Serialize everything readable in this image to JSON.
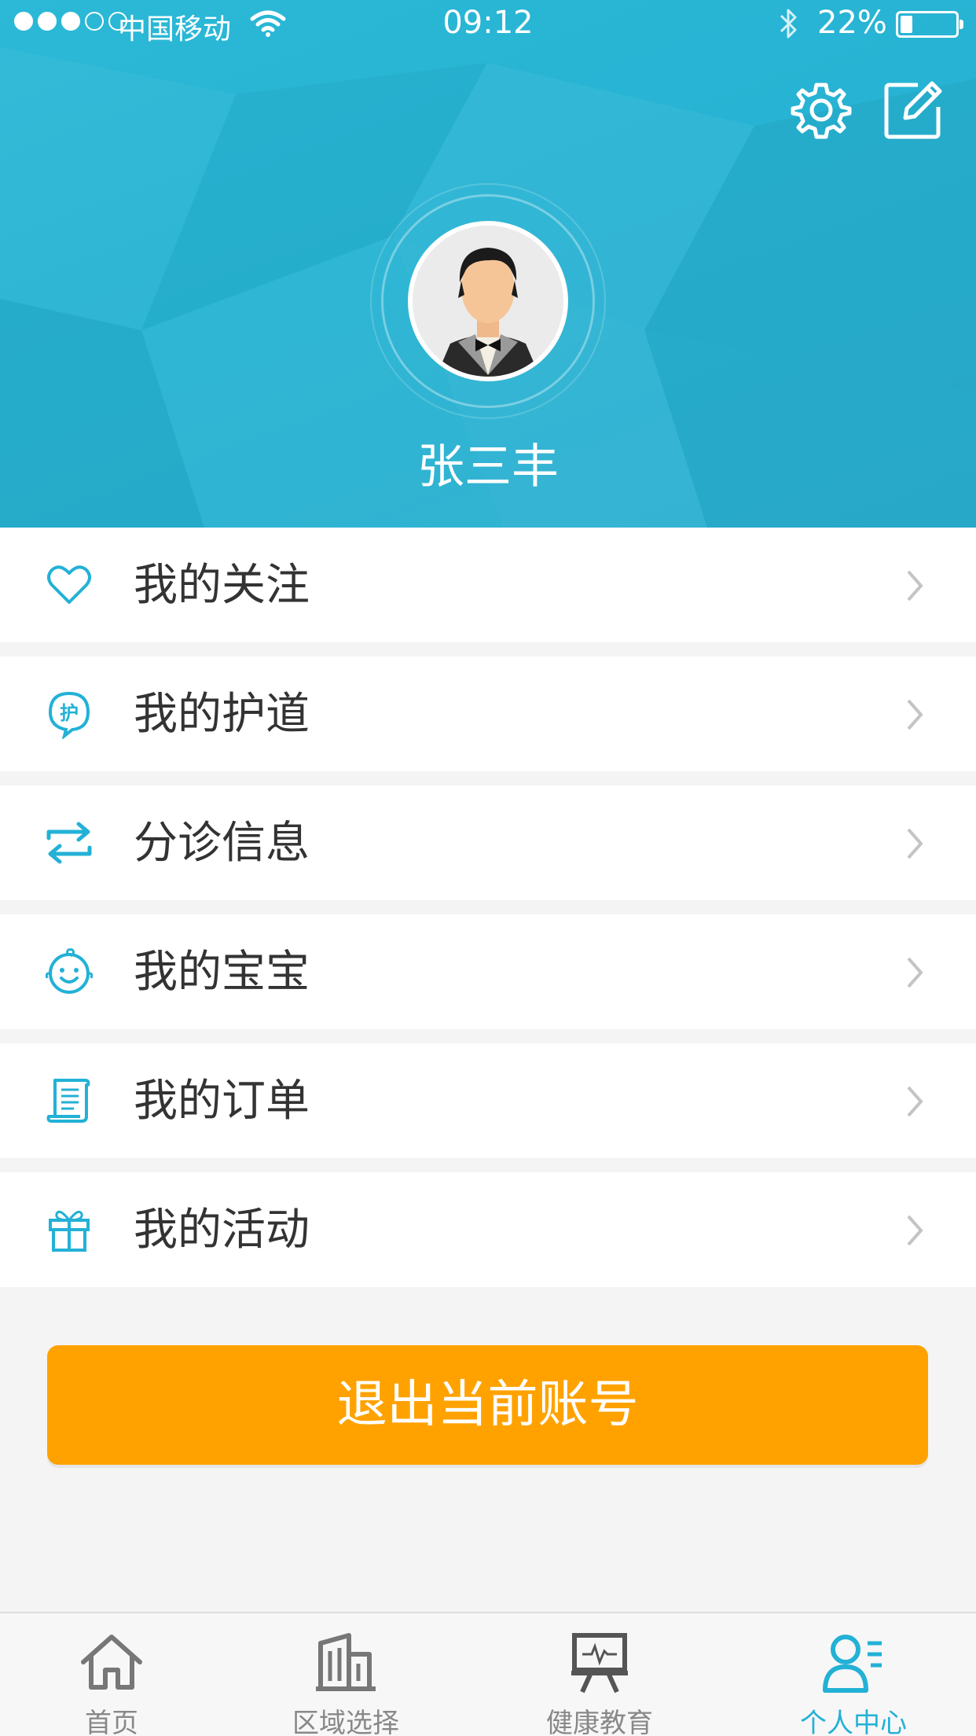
{
  "status_bar": {
    "carrier": "中国移动",
    "time": "09:12",
    "battery": "22%",
    "battery_level": 0.22,
    "signal_bars": 3
  },
  "profile": {
    "name": "张三丰"
  },
  "menu": {
    "items": [
      {
        "label": "我的关注",
        "icon": "heart-icon"
      },
      {
        "label": "我的护道",
        "icon": "hu-badge-icon"
      },
      {
        "label": "分诊信息",
        "icon": "transfer-arrows-icon"
      },
      {
        "label": "我的宝宝",
        "icon": "baby-face-icon"
      },
      {
        "label": "我的订单",
        "icon": "order-list-icon"
      },
      {
        "label": "我的活动",
        "icon": "gift-icon"
      }
    ]
  },
  "logout": {
    "label": "退出当前账号"
  },
  "tab_bar": {
    "tabs": [
      {
        "label": "首页",
        "icon": "home-icon"
      },
      {
        "label": "区域选择",
        "icon": "buildings-icon"
      },
      {
        "label": "健康教育",
        "icon": "presentation-board-icon"
      },
      {
        "label": "个人中心",
        "icon": "profile-list-icon",
        "active": true
      }
    ]
  },
  "colors": {
    "header": "#27b3d3",
    "accent": "#23b1d6",
    "logout": "#ffa200"
  }
}
